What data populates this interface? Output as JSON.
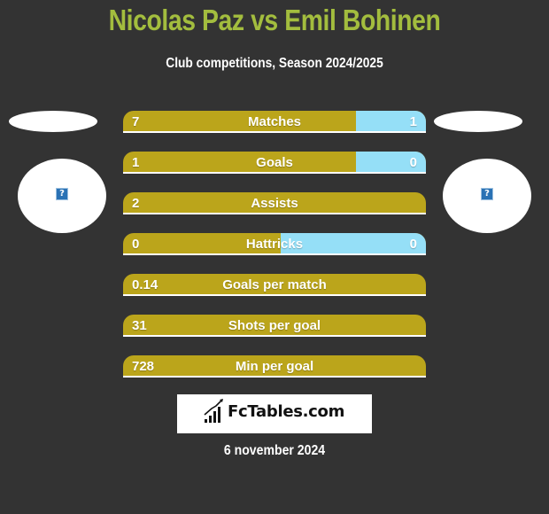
{
  "header": {
    "title": "Nicolas Paz vs Emil Bohinen",
    "subtitle": "Club competitions, Season 2024/2025"
  },
  "players": {
    "left": {
      "name": "Nicolas Paz",
      "avatar_icon": "image-placeholder-icon",
      "avatar_glyph": "?"
    },
    "right": {
      "name": "Emil Bohinen",
      "avatar_icon": "image-placeholder-icon",
      "avatar_glyph": "?"
    }
  },
  "colors": {
    "background": "#333333",
    "title": "#a3bd3e",
    "left_bar": "#bba51b",
    "right_bar": "#95dff7"
  },
  "stats": [
    {
      "label": "Matches",
      "left": "7",
      "right": "1",
      "right_share": 0.23
    },
    {
      "label": "Goals",
      "left": "1",
      "right": "0",
      "right_share": 0.23
    },
    {
      "label": "Assists",
      "left": "2",
      "right": "",
      "right_share": 0
    },
    {
      "label": "Hattricks",
      "left": "0",
      "right": "0",
      "right_share": 0.48
    },
    {
      "label": "Goals per match",
      "left": "0.14",
      "right": "",
      "right_share": 0
    },
    {
      "label": "Shots per goal",
      "left": "31",
      "right": "",
      "right_share": 0
    },
    {
      "label": "Min per goal",
      "left": "728",
      "right": "",
      "right_share": 0
    }
  ],
  "brand": {
    "text": "FcTables.com",
    "icon": "bar-chart-trend-icon"
  },
  "footer": {
    "date": "6 november 2024"
  }
}
